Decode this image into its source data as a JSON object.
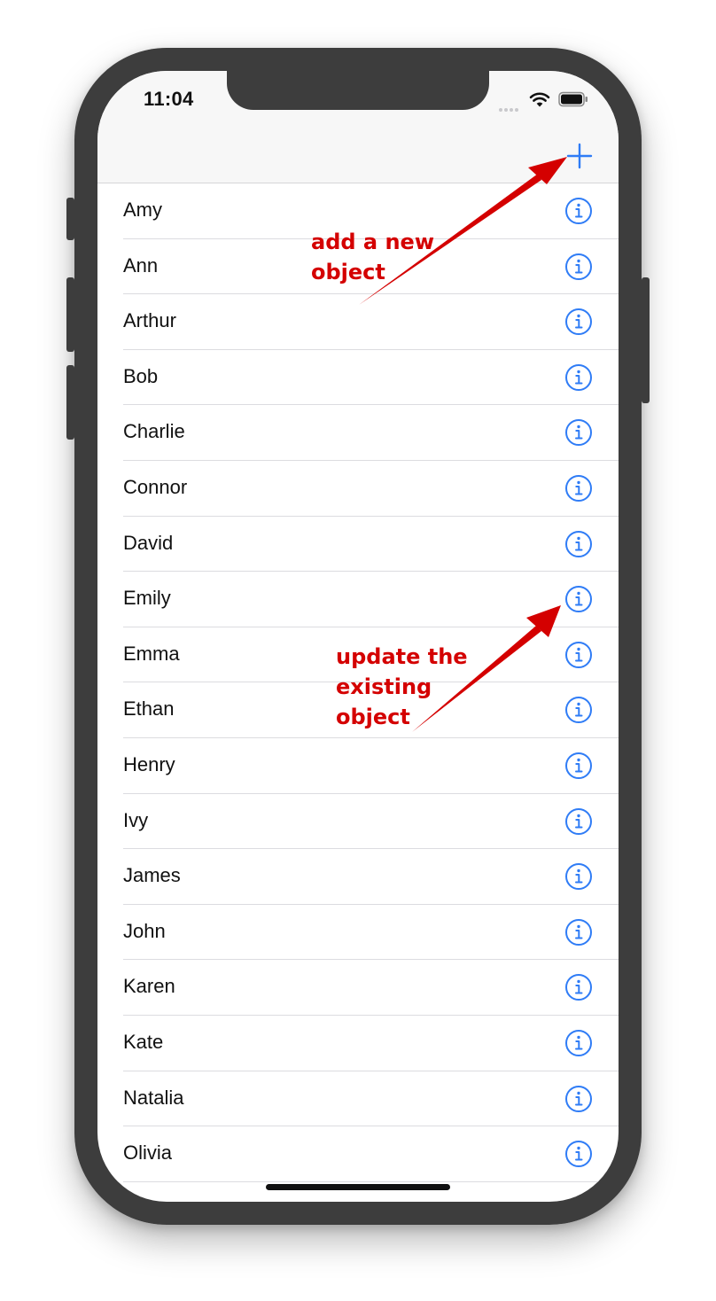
{
  "status_bar": {
    "time": "11:04"
  },
  "navbar": {
    "add_icon": "plus-icon"
  },
  "list": {
    "info_icon": "info-circle-icon",
    "items": [
      "Amy",
      "Ann",
      "Arthur",
      "Bob",
      "Charlie",
      "Connor",
      "David",
      "Emily",
      "Emma",
      "Ethan",
      "Henry",
      "Ivy",
      "James",
      "John",
      "Karen",
      "Kate",
      "Natalia",
      "Olivia"
    ]
  },
  "annotations": {
    "add": "add a new\nobject",
    "update": "update the\nexisting\nobject"
  },
  "colors": {
    "accent": "#2f7cf6",
    "annotation": "#d40000",
    "bezel": "#3d3d3d"
  }
}
